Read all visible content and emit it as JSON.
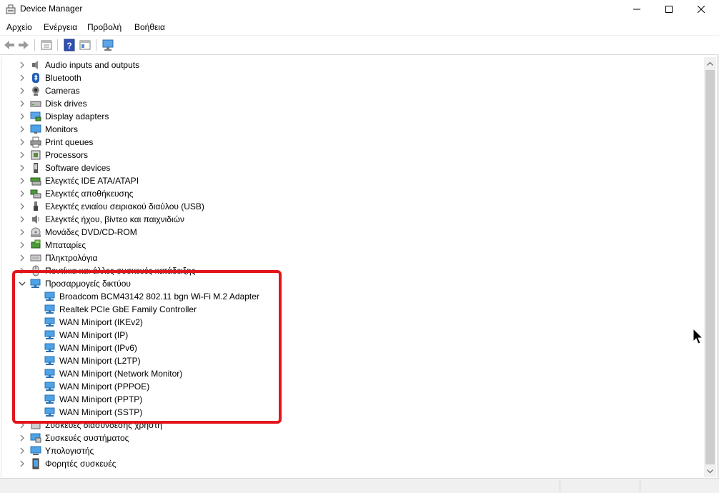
{
  "window": {
    "title": "Device Manager",
    "controls": [
      "minimize",
      "maximize",
      "close"
    ]
  },
  "menubar": {
    "items": [
      "Αρχείο",
      "Ενέργεια",
      "Προβολή",
      "Βοήθεια"
    ]
  },
  "toolbar": {
    "buttons": [
      "back-icon",
      "forward-icon",
      "properties-icon",
      "help-icon",
      "view-icon",
      "scan-hardware-icon"
    ]
  },
  "tree": {
    "items": [
      {
        "label": "Audio inputs and outputs",
        "icon": "speaker-icon",
        "expanded": false
      },
      {
        "label": "Bluetooth",
        "icon": "bluetooth-icon",
        "expanded": false
      },
      {
        "label": "Cameras",
        "icon": "camera-icon",
        "expanded": false
      },
      {
        "label": "Disk drives",
        "icon": "disk-icon",
        "expanded": false
      },
      {
        "label": "Display adapters",
        "icon": "display-adapter-icon",
        "expanded": false
      },
      {
        "label": "Monitors",
        "icon": "monitor-icon",
        "expanded": false
      },
      {
        "label": "Print queues",
        "icon": "printer-icon",
        "expanded": false
      },
      {
        "label": "Processors",
        "icon": "processor-icon",
        "expanded": false
      },
      {
        "label": "Software devices",
        "icon": "software-device-icon",
        "expanded": false
      },
      {
        "label": "Ελεγκτές IDE ATA/ATAPI",
        "icon": "ide-icon",
        "expanded": false
      },
      {
        "label": "Ελεγκτές αποθήκευσης",
        "icon": "storage-icon",
        "expanded": false
      },
      {
        "label": "Ελεγκτές ενιαίου σειριακού διαύλου (USB)",
        "icon": "usb-icon",
        "expanded": false
      },
      {
        "label": "Ελεγκτές ήχου, βίντεο και παιχνιδιών",
        "icon": "sound-icon",
        "expanded": false
      },
      {
        "label": "Μονάδες DVD/CD-ROM",
        "icon": "dvd-icon",
        "expanded": false
      },
      {
        "label": "Μπαταρίες",
        "icon": "battery-icon",
        "expanded": false
      },
      {
        "label": "Πληκτρολόγια",
        "icon": "keyboard-icon",
        "expanded": false
      },
      {
        "label": "Ποντίκια και άλλες συσκευές κατάδειξης",
        "icon": "mouse-icon",
        "expanded": false
      },
      {
        "label": "Προσαρμογείς δικτύου",
        "icon": "network-icon",
        "expanded": true
      },
      {
        "label": "Broadcom BCM43142 802.11 bgn Wi-Fi M.2 Adapter",
        "icon": "network-icon",
        "child": true
      },
      {
        "label": "Realtek PCIe GbE Family Controller",
        "icon": "network-icon",
        "child": true
      },
      {
        "label": "WAN Miniport (IKEv2)",
        "icon": "network-icon",
        "child": true
      },
      {
        "label": "WAN Miniport (IP)",
        "icon": "network-icon",
        "child": true
      },
      {
        "label": "WAN Miniport (IPv6)",
        "icon": "network-icon",
        "child": true
      },
      {
        "label": "WAN Miniport (L2TP)",
        "icon": "network-icon",
        "child": true
      },
      {
        "label": "WAN Miniport (Network Monitor)",
        "icon": "network-icon",
        "child": true
      },
      {
        "label": "WAN Miniport (PPPOE)",
        "icon": "network-icon",
        "child": true
      },
      {
        "label": "WAN Miniport (PPTP)",
        "icon": "network-icon",
        "child": true
      },
      {
        "label": "WAN Miniport (SSTP)",
        "icon": "network-icon",
        "child": true
      },
      {
        "label": "Συσκευές διασύνδεσης χρήστη",
        "icon": "hid-icon",
        "expanded": false
      },
      {
        "label": "Συσκευές συστήματος",
        "icon": "system-icon",
        "expanded": false
      },
      {
        "label": "Υπολογιστής",
        "icon": "computer-icon",
        "expanded": false
      },
      {
        "label": "Φορητές συσκευές",
        "icon": "portable-device-icon",
        "expanded": false
      }
    ]
  },
  "colors": {
    "highlight": "#e3141b",
    "network_icon": "#2d8fd5"
  }
}
